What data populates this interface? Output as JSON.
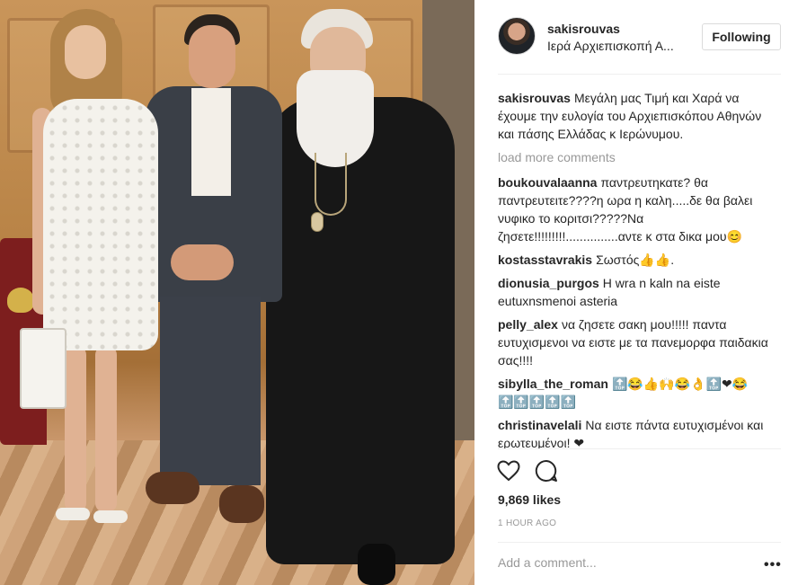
{
  "post": {
    "username": "sakisrouvas",
    "location": "Ιερά Αρχιεπισκοπή Α...",
    "follow_label": "Following",
    "caption": {
      "user": "sakisrouvas",
      "text": "Μεγάλη μας Τιμή και Χαρά να έχουμε την ευλογία του Αρχιεπισκόπου Αθηνών και πάσης Ελλάδας κ Ιερώνυμου."
    },
    "load_more": "load more comments",
    "comments": [
      {
        "user": "boukouvalaanna",
        "text": "παντρευτηκατε? θα παντρευτειτε????η ωρα η καλη.....δε θα βαλει νυφικο το κοριτσι?????Να ζησετε!!!!!!!!!...............αντε κ στα δικα μου😊"
      },
      {
        "user": "kostasstavrakis",
        "text": "Σωστός👍👍."
      },
      {
        "user": "dionusia_purgos",
        "text": "H wra n kaln na eiste eutuxnsmenoi asteria"
      },
      {
        "user": "pelly_alex",
        "text": "να ζησετε σακη μου!!!!! παντα ευτυχισμενοι να ειστε με τα πανεμορφα παιδακια σας!!!!"
      },
      {
        "user": "sibylla_the_roman",
        "text": "🔝😂👍🙌😂👌🔝❤😂 🔝🔝🔝🔝🔝"
      },
      {
        "user": "christinavelali",
        "text": "Να ειστε πάντα ευτυχισμένοι και ερωτευμένοι! ❤"
      }
    ],
    "likes": "9,869 likes",
    "time": "1 HOUR AGO",
    "comment_placeholder": "Add a comment...",
    "more_label": "•••",
    "icons": {
      "like": "heart-icon",
      "comment": "speech-bubble-icon"
    }
  }
}
